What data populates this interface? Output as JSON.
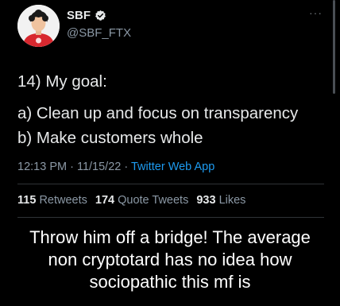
{
  "tweet": {
    "display_name": "SBF",
    "handle": "@SBF_FTX",
    "more": "···",
    "text_line_1": "14) My goal:",
    "text_line_2": "a) Clean up and focus on transparency",
    "text_line_3": "b) Make customers whole",
    "time": "12:13 PM",
    "separator_1": " · ",
    "date": "11/15/22",
    "separator_2": " · ",
    "source": "Twitter Web App",
    "stats": {
      "retweets_count": "115",
      "retweets_label": "Retweets",
      "quote_count": "174",
      "quote_label": "Quote Tweets",
      "likes_count": "933",
      "likes_label": "Likes"
    }
  },
  "caption": {
    "line_1": "Throw him off a bridge! The average",
    "line_2": "non cryptotard has no idea how",
    "line_3": "sociopathic this mf is"
  },
  "colors": {
    "background": "#000000",
    "text": "#e7e9ea",
    "secondary": "#8b98a5",
    "link": "#1d9bf0",
    "avatar_shirt": "#d8282f"
  },
  "icons": {
    "verified": "verified-badge-icon",
    "more": "more-horizontal-icon"
  }
}
